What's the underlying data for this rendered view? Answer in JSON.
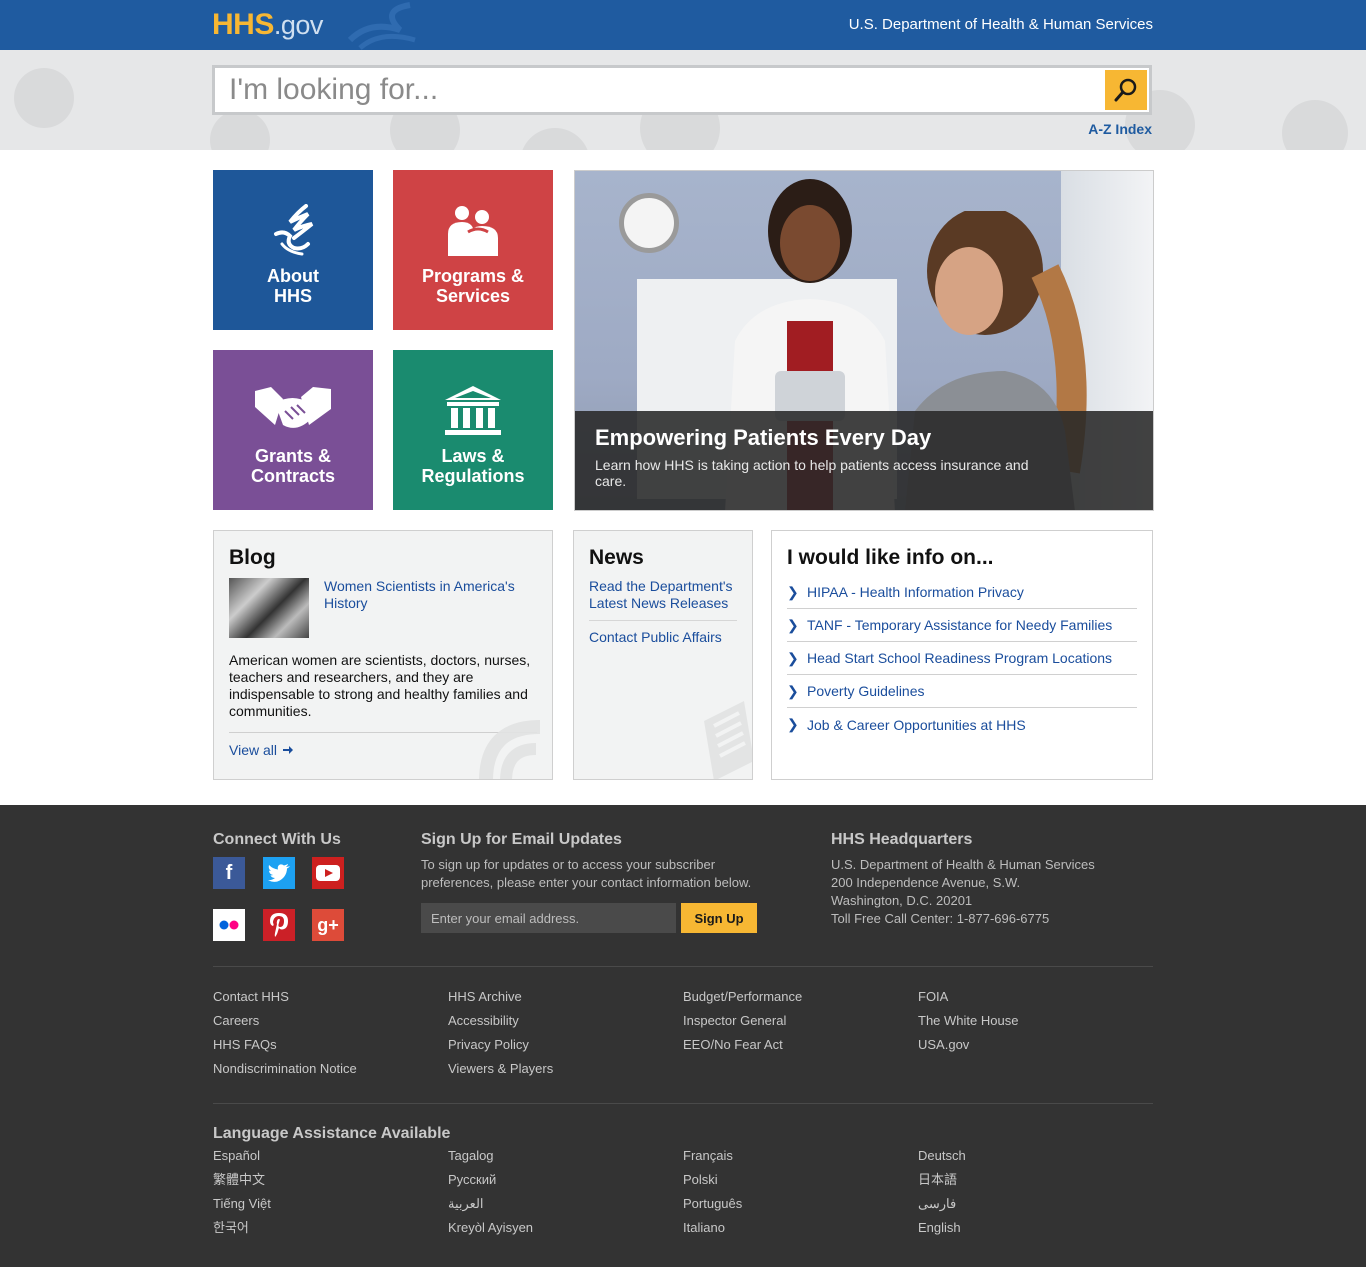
{
  "header": {
    "logo_main": "HHS",
    "logo_suffix": ".gov",
    "department": "U.S. Department of Health & Human Services"
  },
  "search": {
    "placeholder": "I'm looking for...",
    "button_icon": "search-icon",
    "az_index": "A-Z Index"
  },
  "tiles": [
    {
      "label": "About\nHHS",
      "icon": "hhs-eagle-icon",
      "color": "#1e5799"
    },
    {
      "label": "Programs &\nServices",
      "icon": "people-icon",
      "color": "#cf4345"
    },
    {
      "label": "Grants &\nContracts",
      "icon": "handshake-icon",
      "color": "#7a4f96"
    },
    {
      "label": "Laws &\nRegulations",
      "icon": "building-icon",
      "color": "#1a8b6f"
    }
  ],
  "hero": {
    "title": "Empowering Patients Every Day",
    "subtitle": "Learn how HHS is taking action to help patients access insurance and care."
  },
  "blog": {
    "heading": "Blog",
    "post_link": "Women Scientists in America's History",
    "post_text": "American women are scientists, doctors, nurses, teachers and researchers, and they are indispensable to strong and healthy families and communities.",
    "view_all": "View all"
  },
  "news": {
    "heading": "News",
    "links": [
      "Read the Department's Latest News Releases",
      "Contact Public Affairs"
    ]
  },
  "info": {
    "heading": "I would like info on...",
    "items": [
      "HIPAA - Health Information Privacy",
      "TANF - Temporary Assistance for Needy Families",
      "Head Start School Readiness Program Locations",
      "Poverty Guidelines",
      "Job & Career Opportunities at HHS"
    ]
  },
  "footer": {
    "connect_heading": "Connect With Us",
    "social": [
      {
        "name": "facebook",
        "glyph": "f",
        "color": "#3b5998"
      },
      {
        "name": "twitter",
        "glyph": "t",
        "color": "#1da1f2"
      },
      {
        "name": "youtube",
        "glyph": "▶",
        "color": "#cd201f"
      },
      {
        "name": "flickr",
        "glyph": "●●",
        "color": "#ffffff"
      },
      {
        "name": "pinterest",
        "glyph": "P",
        "color": "#cb2027"
      },
      {
        "name": "googleplus",
        "glyph": "g+",
        "color": "#dd4b39"
      }
    ],
    "email_heading": "Sign Up for Email Updates",
    "email_text": "To sign up for updates or to access your subscriber preferences, please enter your contact information below.",
    "email_placeholder": "Enter your email address.",
    "signup_label": "Sign Up",
    "hq_heading": "HHS Headquarters",
    "hq_lines": [
      "U.S. Department of Health & Human Services",
      "200 Independence Avenue, S.W.",
      "Washington, D.C. 20201",
      "Toll Free Call Center: 1-877-696-6775"
    ],
    "link_columns": [
      [
        "Contact HHS",
        "Careers",
        "HHS FAQs",
        "Nondiscrimination Notice"
      ],
      [
        "HHS Archive",
        "Accessibility",
        "Privacy Policy",
        "Viewers & Players"
      ],
      [
        "Budget/Performance",
        "Inspector General",
        "EEO/No Fear Act"
      ],
      [
        "FOIA",
        "The White House",
        "USA.gov"
      ]
    ],
    "language_heading": "Language Assistance Available",
    "language_columns": [
      [
        "Español",
        "繁體中文",
        "Tiếng Việt",
        "한국어"
      ],
      [
        "Tagalog",
        "Русский",
        "العربية",
        "Kreyòl Ayisyen"
      ],
      [
        "Français",
        "Polski",
        "Português",
        "Italiano"
      ],
      [
        "Deutsch",
        "日本語",
        "فارسی",
        "English"
      ]
    ]
  }
}
